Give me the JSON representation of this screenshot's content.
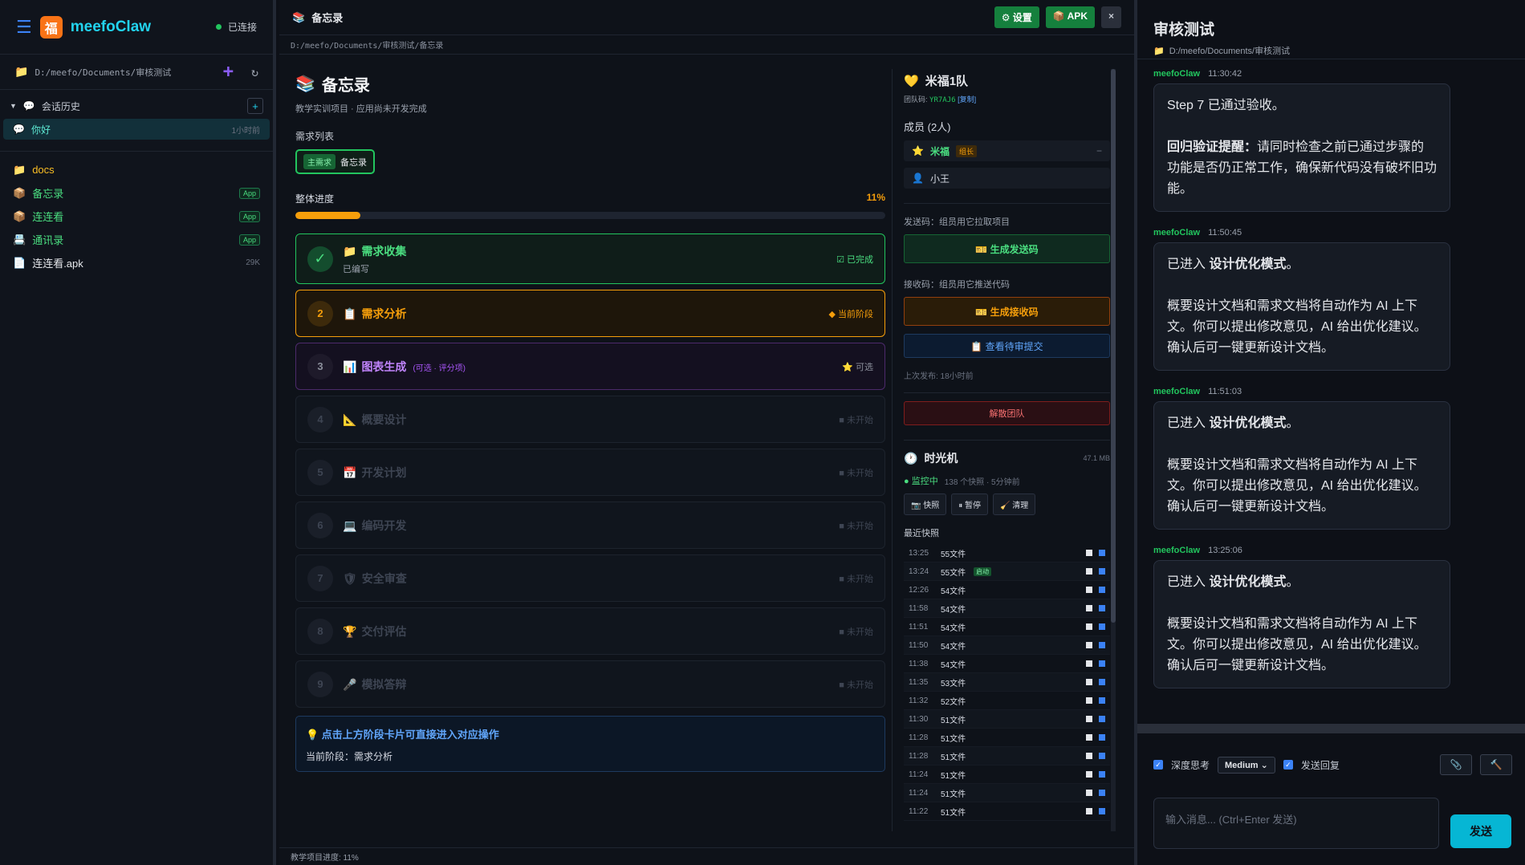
{
  "sidebar": {
    "app_name": "meefoClaw",
    "logo_glyph": "福",
    "status": "已连接",
    "path": "D:/meefo/Documents/审核测试",
    "history_label": "会话历史",
    "session": {
      "name": "你好",
      "time": "1小时前"
    },
    "files": [
      {
        "name": "docs",
        "kind": "folder",
        "badge": "",
        "size": ""
      },
      {
        "name": "备忘录",
        "kind": "app",
        "badge": "App",
        "size": ""
      },
      {
        "name": "连连看",
        "kind": "app",
        "badge": "App",
        "size": ""
      },
      {
        "name": "通讯录",
        "kind": "app",
        "badge": "App",
        "size": ""
      },
      {
        "name": "连连看.apk",
        "kind": "file",
        "badge": "",
        "size": "29K"
      }
    ]
  },
  "main": {
    "tab_title": "备忘录",
    "settings_label": "⚙ 设置",
    "apk_label": "📦 APK",
    "close_label": "×",
    "breadcrumb": "D:/meefo/Documents/审核测试/备忘录",
    "project": {
      "title": "备忘录",
      "subtitle": "教学实训项目 · 应用尚未开发完成",
      "req_list_label": "需求列表",
      "req_tag": "主需求",
      "req_name": "备忘录",
      "progress_label": "整体进度",
      "progress_pct": "11%",
      "progress_value": 0.11
    },
    "stages": [
      {
        "num": "✓",
        "icon": "📁",
        "name": "需求收集",
        "sub": "已编写",
        "note": "",
        "status": "☑ 已完成",
        "state": "done"
      },
      {
        "num": "2",
        "icon": "📋",
        "name": "需求分析",
        "sub": "",
        "note": "",
        "status": "◆ 当前阶段",
        "state": "cur"
      },
      {
        "num": "3",
        "icon": "📊",
        "name": "图表生成",
        "sub": "",
        "note": "(可选 · 评分项)",
        "status": "⭐ 可选",
        "state": "opt"
      },
      {
        "num": "4",
        "icon": "📐",
        "name": "概要设计",
        "sub": "",
        "note": "",
        "status": "■ 未开始",
        "state": "todo"
      },
      {
        "num": "5",
        "icon": "📅",
        "name": "开发计划",
        "sub": "",
        "note": "",
        "status": "■ 未开始",
        "state": "todo"
      },
      {
        "num": "6",
        "icon": "💻",
        "name": "编码开发",
        "sub": "",
        "note": "",
        "status": "■ 未开始",
        "state": "todo"
      },
      {
        "num": "7",
        "icon": "🛡",
        "name": "安全审查",
        "sub": "",
        "note": "",
        "status": "■ 未开始",
        "state": "todo"
      },
      {
        "num": "8",
        "icon": "🏆",
        "name": "交付评估",
        "sub": "",
        "note": "",
        "status": "■ 未开始",
        "state": "todo"
      },
      {
        "num": "9",
        "icon": "🎤",
        "name": "模拟答辩",
        "sub": "",
        "note": "",
        "status": "■ 未开始",
        "state": "todo"
      }
    ],
    "hint_title": "💡 点击上方阶段卡片可直接进入对应操作",
    "hint_current": "当前阶段：需求分析",
    "footer": "教学项目进度: 11%"
  },
  "team": {
    "name": "米福1队",
    "code_label": "团队码:",
    "code": "YR7AJ6",
    "copy": "[复制]",
    "members_label": "成员 (2人)",
    "members": [
      {
        "name": "米福",
        "role": "组长"
      },
      {
        "name": "小王",
        "role": ""
      }
    ],
    "send_code_label": "发送码：组员用它拉取项目",
    "send_code_btn": "🎫 生成发送码",
    "recv_code_label": "接收码：组员用它推送代码",
    "recv_code_btn": "🎫 生成接收码",
    "review_btn": "📋 查看待审提交",
    "last_pub": "上次发布: 18小时前",
    "disband_btn": "解散团队"
  },
  "timemachine": {
    "title": "时光机",
    "size": "47.1 MB",
    "status": "● 监控中",
    "meta": "138 个快照 · 5分钟前",
    "btn_snapshot": "📷 快照",
    "btn_pause": "⏸ 暂停",
    "btn_clean": "🧹 清理",
    "recent_label": "最近快照",
    "snapshots": [
      {
        "time": "13:25",
        "files": "55文件",
        "tag": ""
      },
      {
        "time": "13:24",
        "files": "55文件",
        "tag": "启动"
      },
      {
        "time": "12:26",
        "files": "54文件",
        "tag": ""
      },
      {
        "time": "11:58",
        "files": "54文件",
        "tag": ""
      },
      {
        "time": "11:51",
        "files": "54文件",
        "tag": ""
      },
      {
        "time": "11:50",
        "files": "54文件",
        "tag": ""
      },
      {
        "time": "11:38",
        "files": "54文件",
        "tag": ""
      },
      {
        "time": "11:35",
        "files": "53文件",
        "tag": ""
      },
      {
        "time": "11:32",
        "files": "52文件",
        "tag": ""
      },
      {
        "time": "11:30",
        "files": "51文件",
        "tag": ""
      },
      {
        "time": "11:28",
        "files": "51文件",
        "tag": ""
      },
      {
        "time": "11:28",
        "files": "51文件",
        "tag": ""
      },
      {
        "time": "11:24",
        "files": "51文件",
        "tag": ""
      },
      {
        "time": "11:24",
        "files": "51文件",
        "tag": ""
      },
      {
        "time": "11:22",
        "files": "51文件",
        "tag": ""
      }
    ]
  },
  "chat": {
    "title": "审核测试",
    "path": "D:/meefo/Documents/审核测试",
    "messages": [
      {
        "who": "meefoClaw",
        "time": "11:30:42",
        "p1": "Step 7 已通过验收。",
        "p2b": "回归验证提醒：",
        "p2": "请同时检查之前已通过步骤的功能是否仍正常工作，确保新代码没有破坏旧功能。"
      },
      {
        "who": "meefoClaw",
        "time": "11:50:45",
        "p1a": "已进入 ",
        "p1b": "设计优化模式",
        "p1c": "。",
        "p2": "概要设计文档和需求文档将自动作为 AI 上下文。你可以提出修改意见，AI 给出优化建议。确认后可一键更新设计文档。"
      },
      {
        "who": "meefoClaw",
        "time": "11:51:03",
        "p1a": "已进入 ",
        "p1b": "设计优化模式",
        "p1c": "。",
        "p2": "概要设计文档和需求文档将自动作为 AI 上下文。你可以提出修改意见，AI 给出优化建议。确认后可一键更新设计文档。"
      },
      {
        "who": "meefoClaw",
        "time": "13:25:06",
        "p1a": "已进入 ",
        "p1b": "设计优化模式",
        "p1c": "。",
        "p2": "概要设计文档和需求文档将自动作为 AI 上下文。你可以提出修改意见，AI 给出优化建议。确认后可一键更新设计文档。"
      }
    ],
    "deep_think": "深度思考",
    "model": "Medium",
    "send_reply": "发送回复",
    "placeholder": "输入消息... (Ctrl+Enter 发送)",
    "send": "发送"
  }
}
